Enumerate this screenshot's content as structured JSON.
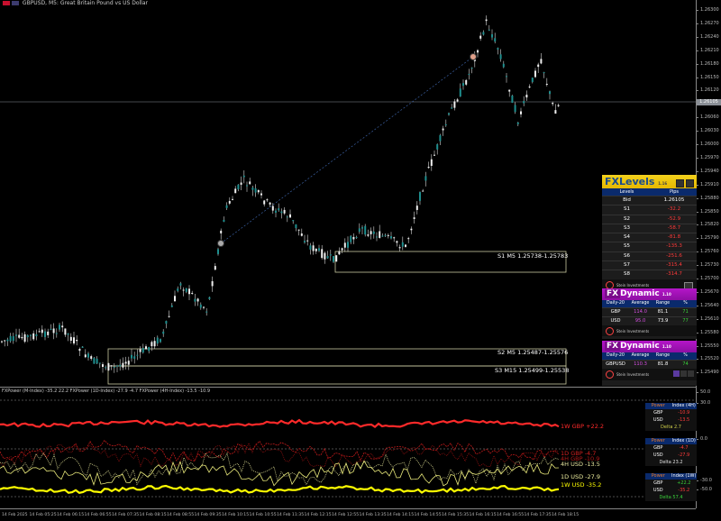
{
  "window": {
    "symbol_title": "GBPUSD, M5:  Great Britain Pound vs US Dollar"
  },
  "price_axis": [
    "1.26300",
    "1.26270",
    "1.26240",
    "1.26210",
    "1.26180",
    "1.26150",
    "1.26120",
    "1.26090",
    "1.26060",
    "1.26030",
    "1.26000",
    "1.25970",
    "1.25940",
    "1.25910",
    "1.25880",
    "1.25850",
    "1.25820",
    "1.25790",
    "1.25760",
    "1.25730",
    "1.25700",
    "1.25670",
    "1.25640",
    "1.25610",
    "1.25580",
    "1.25550",
    "1.25520",
    "1.25490"
  ],
  "current_price": "1.26105",
  "sr_zones": [
    {
      "label": "S1 M5 1.25738-1.25783"
    },
    {
      "label": "S2 M5 1.25487-1.25576"
    },
    {
      "label": "S3 M15 1.25499-1.25538"
    }
  ],
  "fxlevels": {
    "title": "FXLevels",
    "version": "1.16",
    "col_levels": "Levels",
    "col_pips": "Pips",
    "rows": [
      {
        "name": "Bid",
        "value": "1.26105"
      },
      {
        "name": "S1",
        "value": "-32.2"
      },
      {
        "name": "S2",
        "value": "-52.9"
      },
      {
        "name": "S3",
        "value": "-58.7"
      },
      {
        "name": "S4",
        "value": "-81.8"
      },
      {
        "name": "S5",
        "value": "-135.3"
      },
      {
        "name": "S6",
        "value": "-251.6"
      },
      {
        "name": "S7",
        "value": "-315.4"
      },
      {
        "name": "S8",
        "value": "-314.7"
      }
    ],
    "brand": "Stein Investments"
  },
  "dynamic1": {
    "title": "Dynamic",
    "version": "1.10",
    "cols": [
      "Daily-20",
      "Average",
      "Range",
      "%"
    ],
    "rows": [
      {
        "c": "GBP",
        "avg": "114.0",
        "range": "81.1",
        "pct": "71"
      },
      {
        "c": "USD",
        "avg": "95.0",
        "range": "73.9",
        "pct": "77"
      }
    ],
    "brand": "Stein Investments"
  },
  "dynamic2": {
    "title": "Dynamic",
    "version": "1.10",
    "cols": [
      "Daily-20",
      "Average",
      "Range",
      "%"
    ],
    "rows": [
      {
        "c": "GBPUSD",
        "avg": "110.3",
        "range": "81.8",
        "pct": "74"
      }
    ],
    "brand": "Stein Investments"
  },
  "indicator": {
    "title": "FXPower (M-Index) -35.2 22.2  FXPower (1D-Index) -27.9 -4.7  FXPower (4H-Index) -13.5 -10.9",
    "labels": [
      {
        "text": "1W GBP +22.2",
        "color": "#ff2a2a"
      },
      {
        "text": "1D GBP -4.7",
        "color": "#d32020"
      },
      {
        "text": "4H GBP -10.9",
        "color": "#b01818"
      },
      {
        "text": "4H USD -13.5",
        "color": "#e8e8a0"
      },
      {
        "text": "1D USD -27.9",
        "color": "#f0f0a0"
      },
      {
        "text": "1W USD -35.2",
        "color": "#ffff00"
      }
    ],
    "axis": [
      "50.0",
      "30.0",
      "0.0",
      "-30.0",
      "-50.0"
    ]
  },
  "fxpower_tables": [
    {
      "h1": "Power",
      "h2": "Index (4H)",
      "rows": [
        {
          "c": "GBP",
          "v": "-10.9"
        },
        {
          "c": "USD",
          "v": "-13.5"
        }
      ],
      "delta": "Delta 2.7"
    },
    {
      "h1": "Power",
      "h2": "Index (1D)",
      "rows": [
        {
          "c": "GBP",
          "v": "-4.7"
        },
        {
          "c": "USD",
          "v": "-27.9"
        }
      ],
      "delta": "Delta 23.2"
    },
    {
      "h1": "Power",
      "h2": "Index (1W)",
      "rows": [
        {
          "c": "GBP",
          "v": "+22.2"
        },
        {
          "c": "USD",
          "v": "-35.2"
        }
      ],
      "delta": "Delta 57.4"
    }
  ],
  "time_axis": [
    "14 Feb 2025",
    "14 Feb 05:25",
    "14 Feb 06:15",
    "14 Feb 06:55",
    "14 Feb 07:35",
    "14 Feb 08:15",
    "14 Feb 08:55",
    "14 Feb 09:35",
    "14 Feb 10:15",
    "14 Feb 10:55",
    "14 Feb 11:35",
    "14 Feb 12:15",
    "14 Feb 12:55",
    "14 Feb 13:35",
    "14 Feb 14:15",
    "14 Feb 14:55",
    "14 Feb 15:35",
    "14 Feb 16:15",
    "14 Feb 16:55",
    "14 Feb 17:35",
    "14 Feb 18:15"
  ]
}
